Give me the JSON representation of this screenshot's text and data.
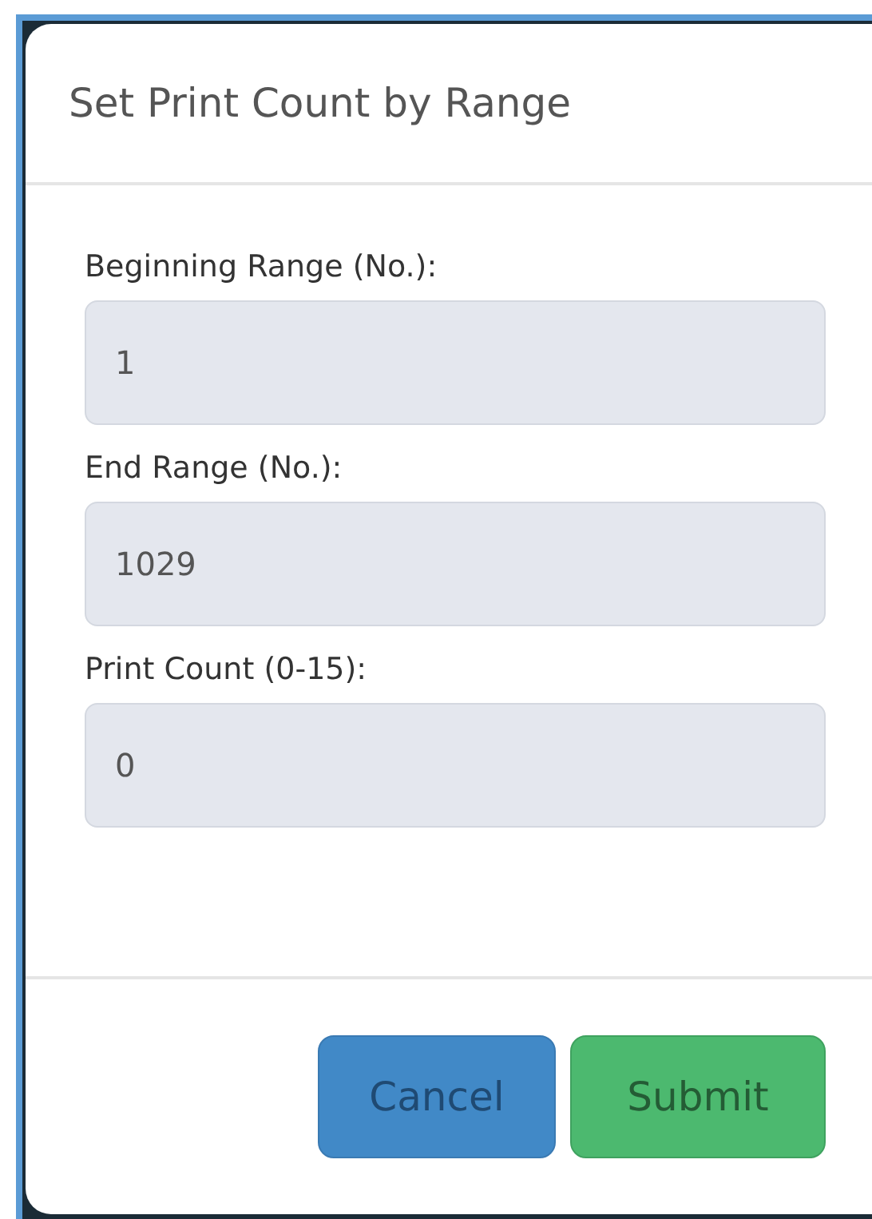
{
  "dialog": {
    "title": "Set Print Count by Range",
    "fields": [
      {
        "label": "Beginning Range (No.):",
        "value": "1"
      },
      {
        "label": "End Range (No.):",
        "value": "1029"
      },
      {
        "label": "Print Count (0-15):",
        "value": "0"
      }
    ],
    "buttons": [
      {
        "kind": "cancel",
        "label": "Cancel"
      },
      {
        "kind": "submit",
        "label": "Submit"
      }
    ]
  }
}
